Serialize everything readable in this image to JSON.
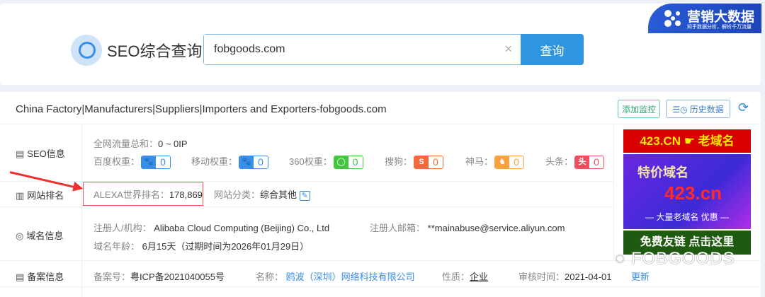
{
  "header": {
    "brand": "SEO综合查询",
    "search_value": "fobgoods.com",
    "clear_icon": "×",
    "query_button": "查询",
    "promo": {
      "title": "营销大数据",
      "subtitle": "知乎数据分析，解析千万流量"
    }
  },
  "result": {
    "site_title": "China Factory|Manufacturers|Suppliers|Importers and Exporters-fobgoods.com",
    "add_monitor": "添加监控",
    "history": "历史数据",
    "refresh_icon": "⟳"
  },
  "labels": {
    "seo": "SEO信息",
    "rank": "网站排名",
    "domain": "域名信息",
    "icp": "备案信息"
  },
  "seo": {
    "traffic_label": "全网流量总和：",
    "traffic_value": "0 ~ 0IP",
    "weights": [
      {
        "label": "百度权重：",
        "value": "0",
        "color": "#3a8ee6",
        "glyph": "🐾"
      },
      {
        "label": "移动权重：",
        "value": "0",
        "color": "#3a8ee6",
        "glyph": "🐾"
      },
      {
        "label": "360权重：",
        "value": "0",
        "color": "#43c53f",
        "glyph": "◯"
      },
      {
        "label": "搜狗：",
        "value": "0",
        "color": "#f26a3c",
        "glyph": "S"
      },
      {
        "label": "神马：",
        "value": "0",
        "color": "#f7a23a",
        "glyph": "♞"
      },
      {
        "label": "头条：",
        "value": "0",
        "color": "#ef4e5e",
        "glyph": "头"
      }
    ]
  },
  "rank": {
    "alexa_label": "ALEXA世界排名：",
    "alexa_value": "178,869",
    "category_label": "网站分类：",
    "category_value": "综合其他"
  },
  "domain": {
    "registrant_label": "注册人/机构：",
    "registrant_value": "Alibaba Cloud Computing (Beijing) Co., Ltd",
    "email_label": "注册人邮箱：",
    "email_value": "**mainabuse@service.aliyun.com",
    "age_label": "域名年龄：",
    "age_value": "6月15天（过期时间为2026年01月29日）"
  },
  "icp": {
    "no_label": "备案号：",
    "no_value": "粤ICP备2021040055号",
    "name_label": "名称：",
    "name_value": "鸥波（深圳）网络科技有限公司",
    "type_label": "性质：",
    "type_value": "企业",
    "date_label": "审核时间：",
    "date_value": "2021-04-01",
    "update": "更新"
  },
  "ad": {
    "top": "423.CN ☛ 老域名",
    "mid_title": "特价域名",
    "mid_domain": "423.cn",
    "mid_sub": "— 大量老域名 优惠 —",
    "bottom": "免费友链 点击这里"
  },
  "watermark": "FOBGOODS"
}
